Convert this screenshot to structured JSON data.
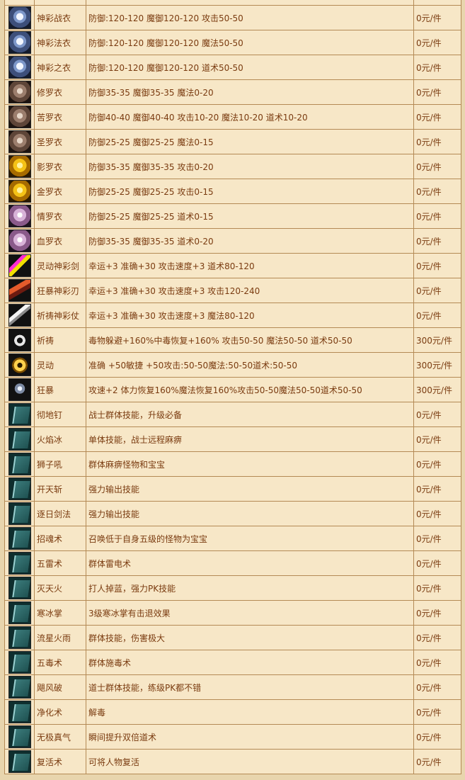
{
  "rows": [
    {
      "icon": "armor-blue",
      "name": "神彩战衣",
      "desc": "防御:120-120 魔御120-120 攻击50-50",
      "price": "0元/件"
    },
    {
      "icon": "armor-blue",
      "name": "神彩法衣",
      "desc": "防御:120-120 魔御120-120 魔法50-50",
      "price": "0元/件"
    },
    {
      "icon": "armor-blue",
      "name": "神彩之衣",
      "desc": "防御:120-120 魔御120-120 道术50-50",
      "price": "0元/件"
    },
    {
      "icon": "armor-brown",
      "name": "修罗衣",
      "desc": "防御35-35 魔御35-35 魔法0-20",
      "price": "0元/件"
    },
    {
      "icon": "armor-brown",
      "name": "苦罗衣",
      "desc": "防御40-40 魔御40-40 攻击10-20 魔法10-20 道术10-20",
      "price": "0元/件"
    },
    {
      "icon": "armor-brown",
      "name": "圣罗衣",
      "desc": "防御25-25 魔御25-25 魔法0-15",
      "price": "0元/件"
    },
    {
      "icon": "armor-gold",
      "name": "影罗衣",
      "desc": "防御35-35 魔御35-35 攻击0-20",
      "price": "0元/件"
    },
    {
      "icon": "armor-gold",
      "name": "金罗衣",
      "desc": "防御25-25 魔御25-25 攻击0-15",
      "price": "0元/件"
    },
    {
      "icon": "armor-pink",
      "name": "情罗衣",
      "desc": "防御25-25 魔御25-25 道术0-15",
      "price": "0元/件"
    },
    {
      "icon": "armor-pink",
      "name": "血罗衣",
      "desc": "防御35-35 魔御35-35 道术0-20",
      "price": "0元/件"
    },
    {
      "icon": "sword1",
      "name": "灵动神彩剑",
      "desc": "幸运+3 准确+30 攻击速度+3 道术80-120",
      "price": "0元/件"
    },
    {
      "icon": "sword2",
      "name": "狂暴神彩刃",
      "desc": "幸运+3 准确+30 攻击速度+3 攻击120-240",
      "price": "0元/件"
    },
    {
      "icon": "staff",
      "name": "祈祷神彩仗",
      "desc": "幸运+3 准确+30 攻击速度+3 魔法80-120",
      "price": "0元/件"
    },
    {
      "icon": "ring1",
      "name": "祈祷",
      "desc": "毒物躲避+160%中毒恢复+160% 攻击50-50 魔法50-50 道术50-50",
      "price": "300元/件"
    },
    {
      "icon": "ring2",
      "name": "灵动",
      "desc": "准确 +50敏捷 +50攻击:50-50魔法:50-50道术:50-50",
      "price": "300元/件"
    },
    {
      "icon": "neck",
      "name": "狂暴",
      "desc": "攻速+2 体力恢复160%魔法恢复160%攻击50-50魔法50-50道术50-50",
      "price": "300元/件"
    },
    {
      "icon": "book",
      "name": "彻地钉",
      "desc": "战士群体技能，升级必备",
      "price": "0元/件"
    },
    {
      "icon": "book",
      "name": "火焰冰",
      "desc": "单体技能，战士远程麻痹",
      "price": "0元/件"
    },
    {
      "icon": "book",
      "name": "狮子吼",
      "desc": "群体麻痹怪物和宝宝",
      "price": "0元/件"
    },
    {
      "icon": "book",
      "name": "开天斩",
      "desc": "强力输出技能",
      "price": "0元/件"
    },
    {
      "icon": "book",
      "name": "逐日剑法",
      "desc": "强力输出技能",
      "price": "0元/件"
    },
    {
      "icon": "book",
      "name": "招魂术",
      "desc": "召唤低于自身五级的怪物为宝宝",
      "price": "0元/件"
    },
    {
      "icon": "book",
      "name": "五雷术",
      "desc": "群体雷电术",
      "price": "0元/件"
    },
    {
      "icon": "book",
      "name": "灭天火",
      "desc": "打人掉蓝，强力PK技能",
      "price": "0元/件"
    },
    {
      "icon": "book",
      "name": "寒冰掌",
      "desc": "3级寒冰掌有击退效果",
      "price": "0元/件"
    },
    {
      "icon": "book",
      "name": "流星火雨",
      "desc": "群体技能，伤害极大",
      "price": "0元/件"
    },
    {
      "icon": "book",
      "name": "五毒术",
      "desc": "群体施毒术",
      "price": "0元/件"
    },
    {
      "icon": "book",
      "name": "飓风破",
      "desc": "道士群体技能，练级PK都不错",
      "price": "0元/件"
    },
    {
      "icon": "book",
      "name": "净化术",
      "desc": "解毒",
      "price": "0元/件"
    },
    {
      "icon": "book",
      "name": "无极真气",
      "desc": "瞬间提升双倍道术",
      "price": "0元/件"
    },
    {
      "icon": "book",
      "name": "复活术",
      "desc": "可将人物复活",
      "price": "0元/件"
    }
  ]
}
